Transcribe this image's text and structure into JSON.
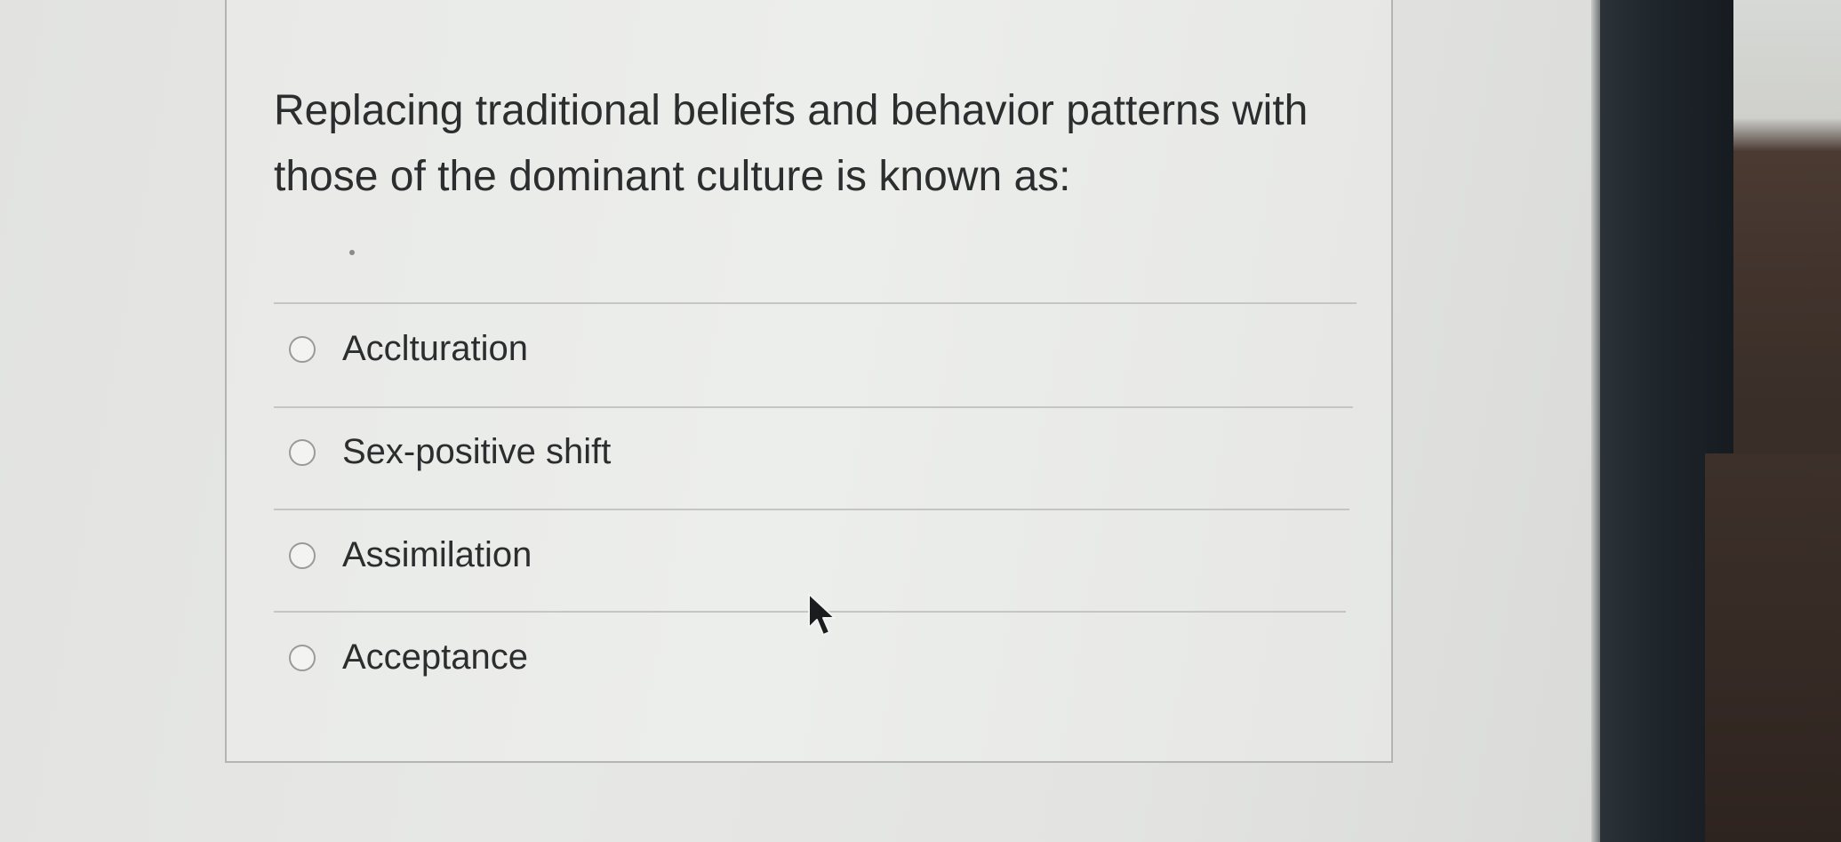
{
  "question": {
    "text": "Replacing traditional beliefs and behavior patterns with those of the dominant culture is known as:"
  },
  "options": [
    {
      "label": "Acclturation",
      "selected": false
    },
    {
      "label": "Sex-positive shift",
      "selected": false
    },
    {
      "label": "Assimilation",
      "selected": false
    },
    {
      "label": "Acceptance",
      "selected": false
    }
  ],
  "icons": {
    "cursor": "mouse-pointer-icon",
    "radio": "radio-button-icon"
  },
  "colors": {
    "text": "#2c2d2f",
    "card_background": "#eceeec",
    "divider": "#c5c6c3",
    "bezel": "#1f262c"
  }
}
